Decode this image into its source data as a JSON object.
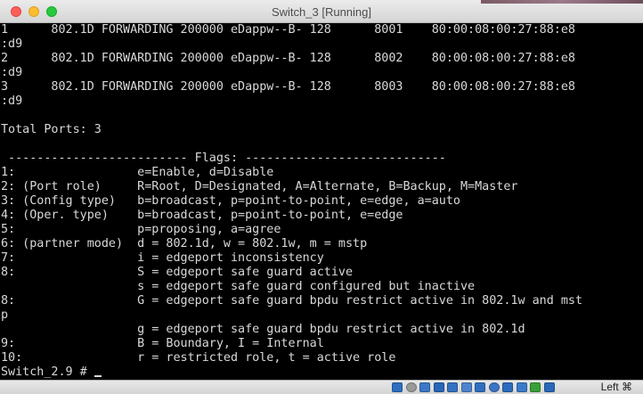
{
  "window": {
    "title": "Switch_3  [Running]"
  },
  "console": {
    "lines": [
      "1      802.1D FORWARDING 200000 eDappw--B- 128      8001    80:00:08:00:27:88:e8",
      ":d9",
      "2      802.1D FORWARDING 200000 eDappw--B- 128      8002    80:00:08:00:27:88:e8",
      ":d9",
      "3      802.1D FORWARDING 200000 eDappw--B- 128      8003    80:00:08:00:27:88:e8",
      ":d9",
      "",
      "Total Ports: 3",
      "",
      " ------------------------- Flags: ----------------------------",
      "1:                 e=Enable, d=Disable",
      "2: (Port role)     R=Root, D=Designated, A=Alternate, B=Backup, M=Master",
      "3: (Config type)   b=broadcast, p=point-to-point, e=edge, a=auto",
      "4: (Oper. type)    b=broadcast, p=point-to-point, e=edge",
      "5:                 p=proposing, a=agree",
      "6: (partner mode)  d = 802.1d, w = 802.1w, m = mstp",
      "7:                 i = edgeport inconsistency",
      "8:                 S = edgeport safe guard active",
      "                   s = edgeport safe guard configured but inactive",
      "8:                 G = edgeport safe guard bpdu restrict active in 802.1w and mst",
      "p",
      "                   g = edgeport safe guard bpdu restrict active in 802.1d",
      "9:                 B = Boundary, I = Internal",
      "10:                r = restricted role, t = active role"
    ],
    "prompt": "Switch_2.9 # "
  },
  "statusbar": {
    "icons": [
      {
        "name": "harddisk-icon",
        "color": "#2f6fc0"
      },
      {
        "name": "optical-drive-icon",
        "color": "#9a9a9a"
      },
      {
        "name": "audio-icon",
        "color": "#3b78c8"
      },
      {
        "name": "network-icon",
        "color": "#2a66b8"
      },
      {
        "name": "usb-icon",
        "color": "#3572c2"
      },
      {
        "name": "shared-folder-icon",
        "color": "#4d84cc"
      },
      {
        "name": "display-icon",
        "color": "#2f6fc0"
      },
      {
        "name": "recording-icon",
        "color": "#3a74c4"
      },
      {
        "name": "cpu-icon",
        "color": "#2d6cbd"
      },
      {
        "name": "mouse-integration-icon",
        "color": "#3a7bc9"
      },
      {
        "name": "guest-additions-icon",
        "color": "#38a038"
      },
      {
        "name": "keyboard-icon",
        "color": "#2a68ba"
      }
    ],
    "host_key": "Left ⌘"
  },
  "colors": {
    "terminal_bg": "#000000",
    "terminal_fg": "#d9d9d9"
  }
}
